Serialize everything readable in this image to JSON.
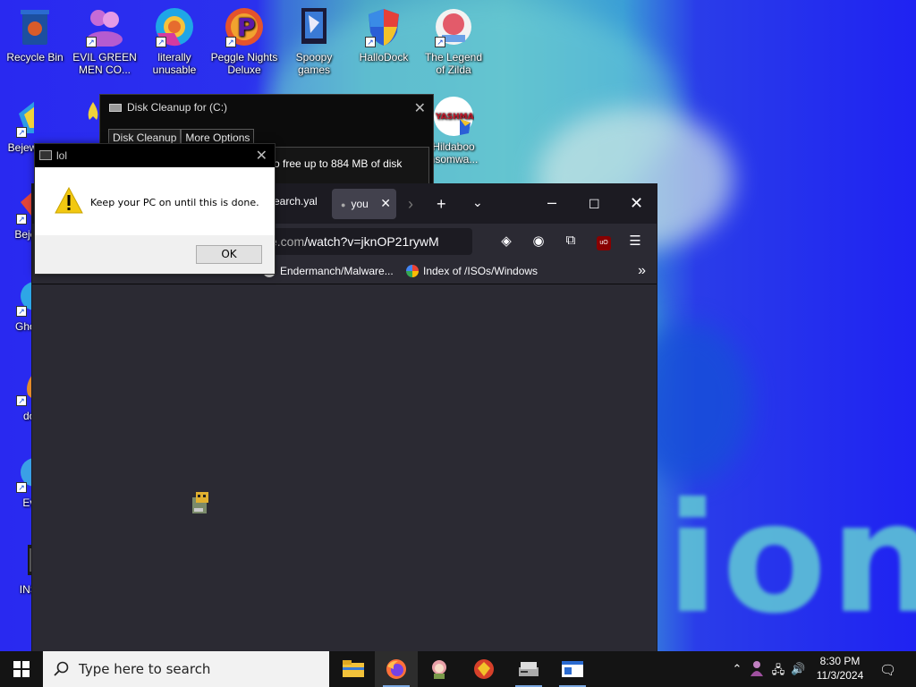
{
  "desktop": {
    "icons": [
      {
        "label": "Recycle Bin"
      },
      {
        "label": "EVIL GREEN MEN CO..."
      },
      {
        "label": "literally unusable"
      },
      {
        "label": "Peggle Nights Deluxe"
      },
      {
        "label": "Spoopy games"
      },
      {
        "label": "HalloDock"
      },
      {
        "label": "The Legend of Zilda"
      },
      {
        "label": "Bejew Delu"
      },
      {
        "label": "Hildaboo nsomwa..."
      },
      {
        "label": "Beje Del"
      },
      {
        "label": "Gho Del"
      },
      {
        "label": "does"
      },
      {
        "label": "Even"
      },
      {
        "label": "INSTA"
      }
    ],
    "yashma_label": "YASHMA",
    "wallpaper_text": "ion"
  },
  "disk_cleanup": {
    "title": "Disk Cleanup for  (C:)",
    "tabs": [
      "Disk Cleanup",
      "More Options"
    ],
    "free_text": "o free up to 884 MB of disk"
  },
  "msgbox": {
    "title": "lol",
    "message": "Keep your PC on until this is done.",
    "ok_label": "OK"
  },
  "browser": {
    "tab_partial": "earch.yal",
    "active_tab": "you",
    "url_prefix": "e.com",
    "url_path": "/watch?v=jknOP21rywM",
    "bookmarks": [
      "Endermanch/Malware...",
      "Index of /ISOs/Windows"
    ]
  },
  "taskbar": {
    "search_placeholder": "Type here to search",
    "time": "8:30 PM",
    "date": "11/3/2024"
  },
  "colors": {
    "firefox_bg": "#2b2a33",
    "firefox_tabbar": "#1c1b22",
    "taskbar": "#141414",
    "wallpaper_blue": "#2929f0"
  }
}
